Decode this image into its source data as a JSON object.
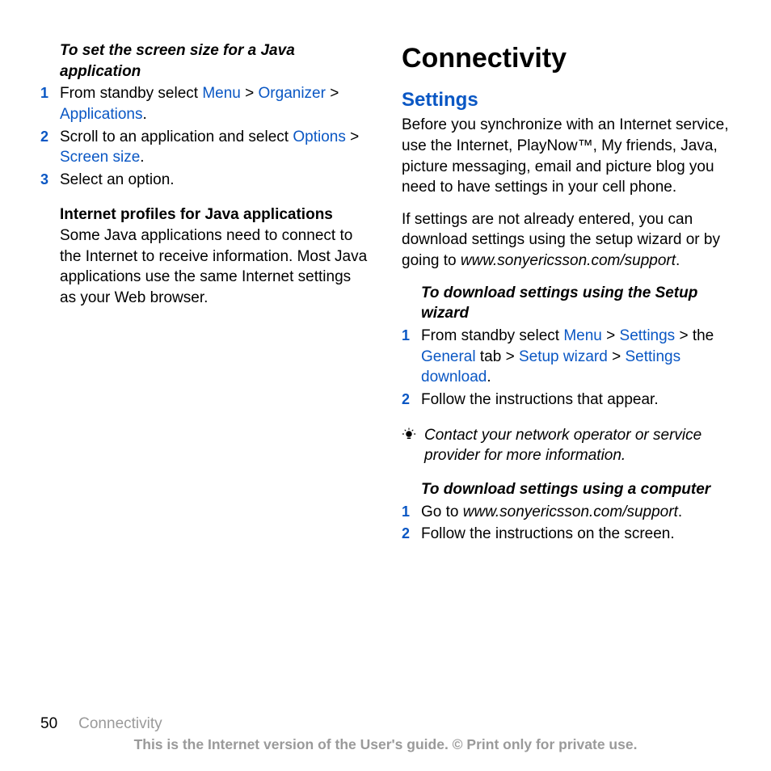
{
  "left": {
    "proc1": {
      "title": "To set the screen size for a Java application",
      "step1": {
        "pre": "From standby select ",
        "l1": "Menu",
        "gt1": " > ",
        "l2": "Organizer",
        "gt2": " > ",
        "l3": "Applications",
        "post": "."
      },
      "step2": {
        "pre": "Scroll to an application and select ",
        "l1": "Options",
        "gt": " > ",
        "l2": "Screen size",
        "post": "."
      },
      "step3": "Select an option."
    },
    "sub": {
      "heading": "Internet profiles for Java applications",
      "body": "Some Java applications need to connect to the Internet to receive information. Most Java applications use the same Internet settings as your Web browser."
    }
  },
  "right": {
    "chapter": "Connectivity",
    "section": "Settings",
    "p1": "Before you synchronize with an Internet service, use the Internet, PlayNow™, My friends, Java, picture messaging, email and picture blog you need to have settings in your cell phone.",
    "p2": {
      "pre": "If settings are not already entered, you can download settings using the setup wizard or by going to ",
      "url": "www.sonyericsson.com/support",
      "post": "."
    },
    "proc2": {
      "title": "To download settings using the Setup wizard",
      "step1": {
        "pre": "From standby select ",
        "l1": "Menu",
        "gt1": " > ",
        "l2": "Settings",
        "gt2": " > the ",
        "l3": "General",
        "mid": " tab > ",
        "l4": "Setup wizard",
        "gt3": " > ",
        "l5": "Settings download",
        "post": "."
      },
      "step2": "Follow the instructions that appear."
    },
    "tip": "Contact your network operator or service provider for more information.",
    "proc3": {
      "title": "To download settings using a computer",
      "step1": {
        "pre": "Go to ",
        "url": "www.sonyericsson.com/support",
        "post": "."
      },
      "step2": "Follow the instructions on the screen."
    }
  },
  "nums": {
    "n1": "1",
    "n2": "2",
    "n3": "3"
  },
  "footer": {
    "page": "50",
    "section": "Connectivity",
    "notice": "This is the Internet version of the User's guide. © Print only for private use."
  }
}
